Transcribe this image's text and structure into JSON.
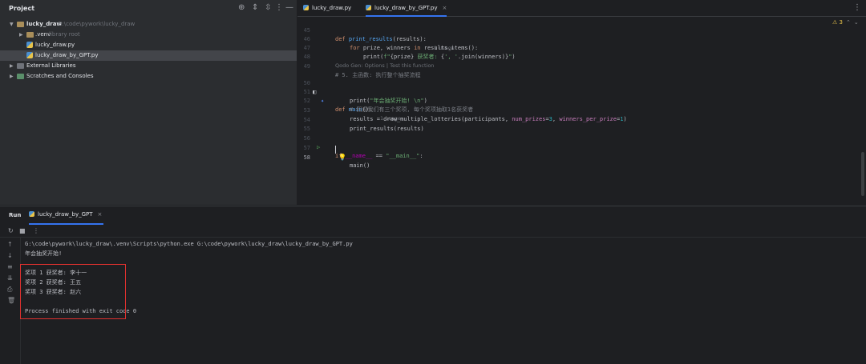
{
  "project": {
    "title": "Project",
    "tree": [
      {
        "name": "lucky_draw",
        "path": "G:\\code\\pywork\\lucky_draw"
      },
      {
        "name": ".venv",
        "note": "library root"
      },
      {
        "name": "lucky_draw.py"
      },
      {
        "name": "lucky_draw_by_GPT.py"
      },
      {
        "name": "External Libraries"
      },
      {
        "name": "Scratches and Consoles"
      }
    ]
  },
  "editor": {
    "tabs": [
      {
        "label": "lucky_draw.py"
      },
      {
        "label": "lucky_draw_by_GPT.py"
      }
    ],
    "warnings": "3",
    "usage_hint": "1 usage",
    "inlay_hint": "Qodo Gen: Options | Test this function",
    "lines": [
      {
        "n": "45",
        "code": "def print_results(results):"
      },
      {
        "n": "46",
        "code": "for prize, winners in results.items():"
      },
      {
        "n": "47",
        "code": "print(f\"{prize} 获奖者: {', '.join(winners)}\")"
      },
      {
        "n": "48",
        "code": ""
      },
      {
        "n": "49",
        "code": "# 5. 主函数: 执行整个抽奖流程"
      },
      {
        "n": "50",
        "code": "def main():"
      },
      {
        "n": "51",
        "code": "print(\"年会抽奖开始! \\n\")"
      },
      {
        "n": "52",
        "code": "# 假设我们有三个奖项, 每个奖项抽取1名获奖者"
      },
      {
        "n": "53",
        "code": "results = draw_multiple_lotteries(participants, num_prizes=3, winners_per_prize=1)"
      },
      {
        "n": "54",
        "code": "print_results(results)"
      },
      {
        "n": "55",
        "code": ""
      },
      {
        "n": "56",
        "code": "if __name__ == \"__main__\":"
      },
      {
        "n": "57",
        "code": "main()"
      },
      {
        "n": "58",
        "code": ""
      }
    ]
  },
  "run": {
    "title": "Run",
    "tab_label": "lucky_draw_by_GPT",
    "console": [
      "G:\\code\\pywork\\lucky_draw\\.venv\\Scripts\\python.exe G:\\code\\pywork\\lucky_draw\\lucky_draw_by_GPT.py",
      "年会抽奖开始!",
      "",
      "奖项 1 获奖者: 李十一",
      "奖项 2 获奖者: 王五",
      "奖项 3 获奖者: 赵六",
      "",
      "Process finished with exit code 0"
    ]
  },
  "colors": {
    "accent": "#3574f0",
    "highlight_border": "#e0312f",
    "keyword": "#cf8e6d",
    "string": "#6aab73",
    "function": "#56a8f5"
  }
}
